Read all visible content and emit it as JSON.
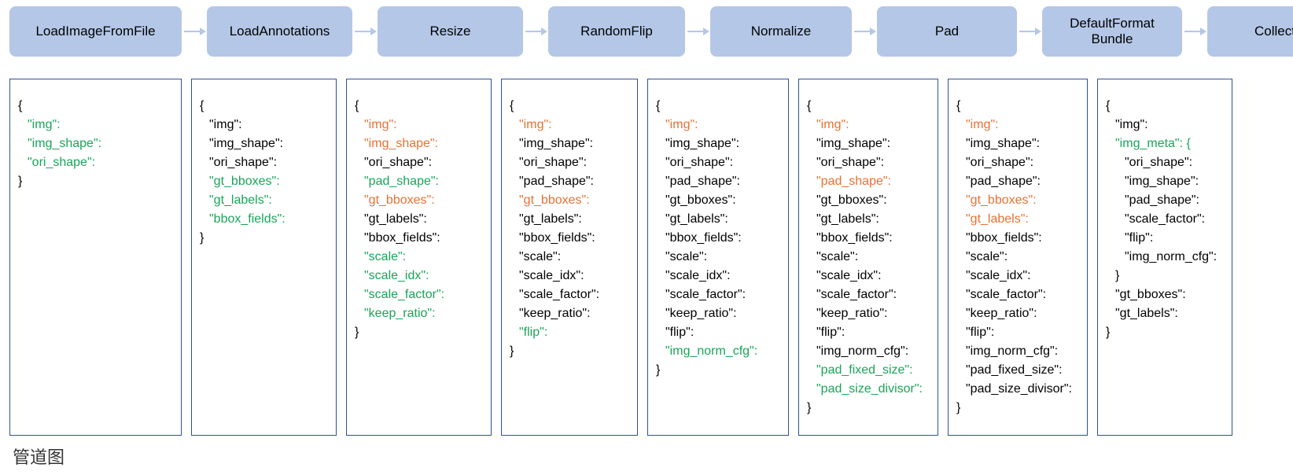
{
  "caption": "管道图",
  "stages": [
    {
      "title": "LoadImageFromFile",
      "lines": [
        {
          "t": "{",
          "c": "k",
          "i": 0
        },
        {
          "t": "\"img\":",
          "c": "g",
          "i": 1
        },
        {
          "t": "\"img_shape\":",
          "c": "g",
          "i": 1
        },
        {
          "t": "\"ori_shape\":",
          "c": "g",
          "i": 1
        },
        {
          "t": "}",
          "c": "k",
          "i": 0
        }
      ]
    },
    {
      "title": "LoadAnnotations",
      "lines": [
        {
          "t": "{",
          "c": "k",
          "i": 0
        },
        {
          "t": "\"img\":",
          "c": "k",
          "i": 1
        },
        {
          "t": "\"img_shape\":",
          "c": "k",
          "i": 1
        },
        {
          "t": "\"ori_shape\":",
          "c": "k",
          "i": 1
        },
        {
          "t": "\"gt_bboxes\":",
          "c": "g",
          "i": 1
        },
        {
          "t": "\"gt_labels\":",
          "c": "g",
          "i": 1
        },
        {
          "t": "\"bbox_fields\":",
          "c": "g",
          "i": 1
        },
        {
          "t": "}",
          "c": "k",
          "i": 0
        }
      ]
    },
    {
      "title": "Resize",
      "lines": [
        {
          "t": "{",
          "c": "k",
          "i": 0
        },
        {
          "t": "\"img\":",
          "c": "o",
          "i": 1
        },
        {
          "t": "\"img_shape\":",
          "c": "o",
          "i": 1
        },
        {
          "t": "\"ori_shape\":",
          "c": "k",
          "i": 1
        },
        {
          "t": "\"pad_shape\":",
          "c": "g",
          "i": 1
        },
        {
          "t": "\"gt_bboxes\":",
          "c": "o",
          "i": 1
        },
        {
          "t": "\"gt_labels\":",
          "c": "k",
          "i": 1
        },
        {
          "t": "\"bbox_fields\":",
          "c": "k",
          "i": 1
        },
        {
          "t": "\"scale\":",
          "c": "g",
          "i": 1
        },
        {
          "t": "\"scale_idx\":",
          "c": "g",
          "i": 1
        },
        {
          "t": "\"scale_factor\":",
          "c": "g",
          "i": 1
        },
        {
          "t": "\"keep_ratio\":",
          "c": "g",
          "i": 1
        },
        {
          "t": "}",
          "c": "k",
          "i": 0
        }
      ]
    },
    {
      "title": "RandomFlip",
      "lines": [
        {
          "t": "{",
          "c": "k",
          "i": 0
        },
        {
          "t": "\"img\":",
          "c": "o",
          "i": 1
        },
        {
          "t": "\"img_shape\":",
          "c": "k",
          "i": 1
        },
        {
          "t": "\"ori_shape\":",
          "c": "k",
          "i": 1
        },
        {
          "t": "\"pad_shape\":",
          "c": "k",
          "i": 1
        },
        {
          "t": "\"gt_bboxes\":",
          "c": "o",
          "i": 1
        },
        {
          "t": "\"gt_labels\":",
          "c": "k",
          "i": 1
        },
        {
          "t": "\"bbox_fields\":",
          "c": "k",
          "i": 1
        },
        {
          "t": "\"scale\":",
          "c": "k",
          "i": 1
        },
        {
          "t": "\"scale_idx\":",
          "c": "k",
          "i": 1
        },
        {
          "t": "\"scale_factor\":",
          "c": "k",
          "i": 1
        },
        {
          "t": "\"keep_ratio\":",
          "c": "k",
          "i": 1
        },
        {
          "t": "\"flip\":",
          "c": "g",
          "i": 1
        },
        {
          "t": "}",
          "c": "k",
          "i": 0
        }
      ]
    },
    {
      "title": "Normalize",
      "lines": [
        {
          "t": "{",
          "c": "k",
          "i": 0
        },
        {
          "t": "\"img\":",
          "c": "o",
          "i": 1
        },
        {
          "t": "\"img_shape\":",
          "c": "k",
          "i": 1
        },
        {
          "t": "\"ori_shape\":",
          "c": "k",
          "i": 1
        },
        {
          "t": "\"pad_shape\":",
          "c": "k",
          "i": 1
        },
        {
          "t": "\"gt_bboxes\":",
          "c": "k",
          "i": 1
        },
        {
          "t": "\"gt_labels\":",
          "c": "k",
          "i": 1
        },
        {
          "t": "\"bbox_fields\":",
          "c": "k",
          "i": 1
        },
        {
          "t": "\"scale\":",
          "c": "k",
          "i": 1
        },
        {
          "t": "\"scale_idx\":",
          "c": "k",
          "i": 1
        },
        {
          "t": "\"scale_factor\":",
          "c": "k",
          "i": 1
        },
        {
          "t": "\"keep_ratio\":",
          "c": "k",
          "i": 1
        },
        {
          "t": "\"flip\":",
          "c": "k",
          "i": 1
        },
        {
          "t": "\"img_norm_cfg\":",
          "c": "g",
          "i": 1
        },
        {
          "t": "}",
          "c": "k",
          "i": 0
        }
      ]
    },
    {
      "title": "Pad",
      "lines": [
        {
          "t": "{",
          "c": "k",
          "i": 0
        },
        {
          "t": "\"img\":",
          "c": "o",
          "i": 1
        },
        {
          "t": "\"img_shape\":",
          "c": "k",
          "i": 1
        },
        {
          "t": "\"ori_shape\":",
          "c": "k",
          "i": 1
        },
        {
          "t": "\"pad_shape\":",
          "c": "o",
          "i": 1
        },
        {
          "t": "\"gt_bboxes\":",
          "c": "k",
          "i": 1
        },
        {
          "t": "\"gt_labels\":",
          "c": "k",
          "i": 1
        },
        {
          "t": "\"bbox_fields\":",
          "c": "k",
          "i": 1
        },
        {
          "t": "\"scale\":",
          "c": "k",
          "i": 1
        },
        {
          "t": "\"scale_idx\":",
          "c": "k",
          "i": 1
        },
        {
          "t": "\"scale_factor\":",
          "c": "k",
          "i": 1
        },
        {
          "t": "\"keep_ratio\":",
          "c": "k",
          "i": 1
        },
        {
          "t": "\"flip\":",
          "c": "k",
          "i": 1
        },
        {
          "t": "\"img_norm_cfg\":",
          "c": "k",
          "i": 1
        },
        {
          "t": "\"pad_fixed_size\":",
          "c": "g",
          "i": 1
        },
        {
          "t": "\"pad_size_divisor\":",
          "c": "g",
          "i": 1
        },
        {
          "t": "}",
          "c": "k",
          "i": 0
        }
      ]
    },
    {
      "title": "DefaultFormat\nBundle",
      "lines": [
        {
          "t": "{",
          "c": "k",
          "i": 0
        },
        {
          "t": "\"img\":",
          "c": "o",
          "i": 1
        },
        {
          "t": "\"img_shape\":",
          "c": "k",
          "i": 1
        },
        {
          "t": "\"ori_shape\":",
          "c": "k",
          "i": 1
        },
        {
          "t": "\"pad_shape\":",
          "c": "k",
          "i": 1
        },
        {
          "t": "\"gt_bboxes\":",
          "c": "o",
          "i": 1
        },
        {
          "t": "\"gt_labels\":",
          "c": "o",
          "i": 1
        },
        {
          "t": "\"bbox_fields\":",
          "c": "k",
          "i": 1
        },
        {
          "t": "\"scale\":",
          "c": "k",
          "i": 1
        },
        {
          "t": "\"scale_idx\":",
          "c": "k",
          "i": 1
        },
        {
          "t": "\"scale_factor\":",
          "c": "k",
          "i": 1
        },
        {
          "t": "\"keep_ratio\":",
          "c": "k",
          "i": 1
        },
        {
          "t": "\"flip\":",
          "c": "k",
          "i": 1
        },
        {
          "t": "\"img_norm_cfg\":",
          "c": "k",
          "i": 1
        },
        {
          "t": "\"pad_fixed_size\":",
          "c": "k",
          "i": 1
        },
        {
          "t": "\"pad_size_divisor\":",
          "c": "k",
          "i": 1
        },
        {
          "t": "}",
          "c": "k",
          "i": 0
        }
      ]
    },
    {
      "title": "Collect",
      "lines": [
        {
          "t": "{",
          "c": "k",
          "i": 0
        },
        {
          "t": "\"img\":",
          "c": "k",
          "i": 1
        },
        {
          "t": "\"img_meta\": {",
          "c": "g",
          "i": 1
        },
        {
          "t": "\"ori_shape\":",
          "c": "k",
          "i": 2
        },
        {
          "t": "\"img_shape\":",
          "c": "k",
          "i": 2
        },
        {
          "t": "\"pad_shape\":",
          "c": "k",
          "i": 2
        },
        {
          "t": "\"scale_factor\":",
          "c": "k",
          "i": 2
        },
        {
          "t": "\"flip\":",
          "c": "k",
          "i": 2
        },
        {
          "t": "\"img_norm_cfg\":",
          "c": "k",
          "i": 2
        },
        {
          "t": "}",
          "c": "k",
          "i": 1
        },
        {
          "t": "\"gt_bboxes\":",
          "c": "k",
          "i": 1
        },
        {
          "t": "\"gt_labels\":",
          "c": "k",
          "i": 1
        },
        {
          "t": "}",
          "c": "k",
          "i": 0
        }
      ]
    }
  ]
}
